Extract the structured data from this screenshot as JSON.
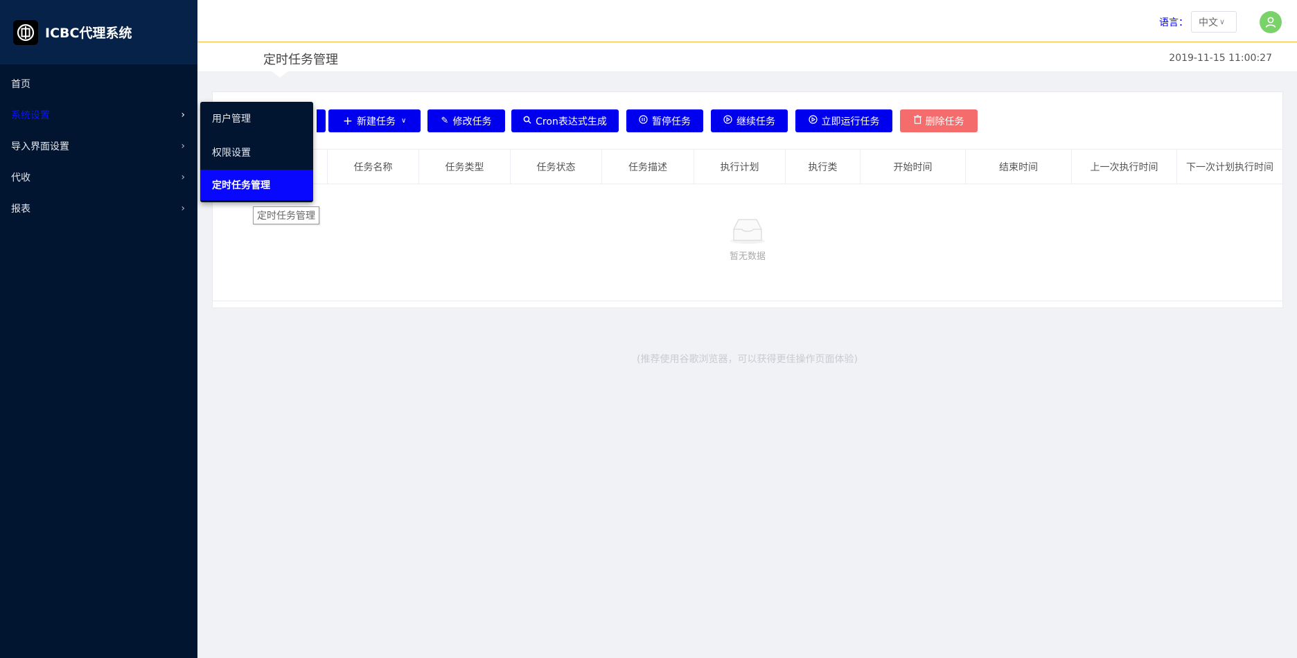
{
  "app": {
    "title": "ICBC代理系统"
  },
  "sidebar": {
    "items": [
      {
        "label": "首页"
      },
      {
        "label": "系统设置"
      },
      {
        "label": "导入界面设置"
      },
      {
        "label": "代收"
      },
      {
        "label": "报表"
      }
    ]
  },
  "submenu": {
    "items": [
      {
        "label": "用户管理"
      },
      {
        "label": "权限设置"
      },
      {
        "label": "定时任务管理"
      }
    ],
    "tooltip": "定时任务管理"
  },
  "header": {
    "lang_label": "语言：",
    "lang_value": "中文"
  },
  "page": {
    "title": "定时任务管理",
    "datetime": "2019-11-15 11:00:27"
  },
  "toolbar": {
    "new_task": "新建任务",
    "edit_task": "修改任务",
    "cron": "Cron表达式生成",
    "pause": "暂停任务",
    "resume": "继续任务",
    "run_now": "立即运行任务",
    "delete": "删除任务"
  },
  "table": {
    "columns": [
      "任务名称",
      "任务类型",
      "任务状态",
      "任务描述",
      "执行计划",
      "执行类",
      "开始时间",
      "结束时间",
      "上一次执行时间",
      "下一次计划执行时间"
    ],
    "empty_text": "暂无数据"
  },
  "footer": {
    "note": "(推荐使用谷歌浏览器，可以获得更佳操作页面体验)"
  },
  "colors": {
    "sidebar_bg": "#011530",
    "primary": "#0000ee",
    "danger": "#f56c6c",
    "avatar": "#7cd26a"
  }
}
